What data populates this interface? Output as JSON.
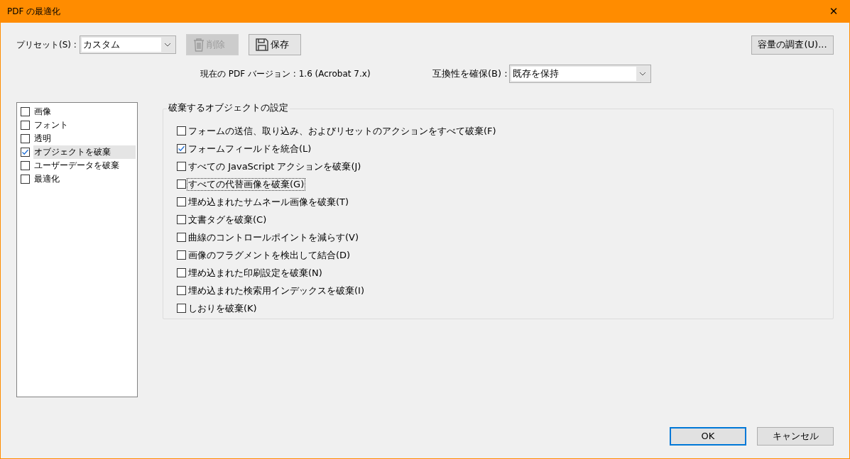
{
  "window": {
    "title": "PDF の最適化",
    "close": "✕"
  },
  "preset": {
    "label": "プリセット(S) :",
    "value": "カスタム"
  },
  "toolbar": [
    {
      "label": "削除",
      "kind": "delete",
      "disabled": true
    },
    {
      "label": "保存",
      "kind": "save",
      "disabled": false
    }
  ],
  "audit_button": "容量の調査(U)...",
  "version_text": "現在の PDF バージョン : 1.6 (Acrobat 7.x)",
  "compatibility": {
    "label": "互換性を確保(B) :",
    "value": "既存を保持"
  },
  "sidebar": {
    "items": [
      {
        "label": "画像",
        "checked": false,
        "selected": false
      },
      {
        "label": "フォント",
        "checked": false,
        "selected": false
      },
      {
        "label": "透明",
        "checked": false,
        "selected": false
      },
      {
        "label": "オブジェクトを破棄",
        "checked": true,
        "selected": true
      },
      {
        "label": "ユーザーデータを破棄",
        "checked": false,
        "selected": false
      },
      {
        "label": "最適化",
        "checked": false,
        "selected": false
      }
    ]
  },
  "group": {
    "title": "破棄するオブジェクトの設定",
    "options": [
      {
        "label": "フォームの送信、取り込み、およびリセットのアクションをすべて破棄(F)",
        "checked": false,
        "focused": false
      },
      {
        "label": "フォームフィールドを統合(L)",
        "checked": true,
        "focused": false
      },
      {
        "label": "すべての JavaScript アクションを破棄(J)",
        "checked": false,
        "focused": false
      },
      {
        "label": "すべての代替画像を破棄(G)",
        "checked": false,
        "focused": true
      },
      {
        "label": "埋め込まれたサムネール画像を破棄(T)",
        "checked": false,
        "focused": false
      },
      {
        "label": "文書タグを破棄(C)",
        "checked": false,
        "focused": false
      },
      {
        "label": "曲線のコントロールポイントを減らす(V)",
        "checked": false,
        "focused": false
      },
      {
        "label": "画像のフラグメントを検出して結合(D)",
        "checked": false,
        "focused": false
      },
      {
        "label": "埋め込まれた印刷設定を破棄(N)",
        "checked": false,
        "focused": false
      },
      {
        "label": "埋め込まれた検索用インデックスを破棄(I)",
        "checked": false,
        "focused": false
      },
      {
        "label": "しおりを破棄(K)",
        "checked": false,
        "focused": false
      }
    ]
  },
  "buttons": [
    {
      "label": "OK",
      "default": true
    },
    {
      "label": "キャンセル",
      "default": false
    }
  ]
}
